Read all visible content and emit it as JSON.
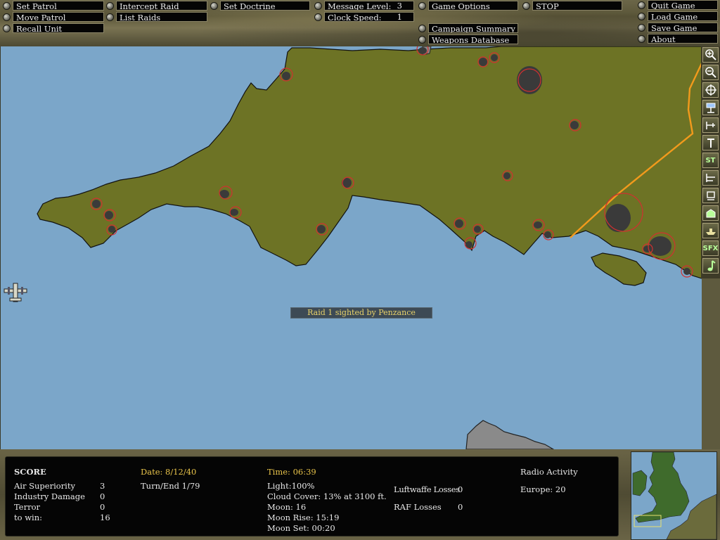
{
  "menu": {
    "set_patrol": "Set Patrol",
    "move_patrol": "Move Patrol",
    "recall_unit": "Recall Unit",
    "intercept_raid": "Intercept Raid",
    "list_raids": "List Raids",
    "set_doctrine": "Set Doctrine",
    "message_level_label": "Message Level:",
    "message_level_value": "3",
    "clock_speed_label": "Clock Speed:",
    "clock_speed_value": "1",
    "game_options": "Game Options",
    "campaign_summary": "Campaign Summary",
    "weapons_database": "Weapons Database",
    "stop": "STOP",
    "quit_game": "Quit Game",
    "load_game": "Load Game",
    "save_game": "Save Game",
    "about": "About"
  },
  "map": {
    "message": "Raid 1 sighted by Penzance",
    "colors": {
      "sea": "#7ba6c9",
      "land": "#6d7325",
      "town": "#3a3a3a",
      "circle": "#d03030",
      "border": "#f29a1c",
      "france": "#8a8a8a"
    }
  },
  "sidetools": {
    "icons": [
      "zoom-in-icon",
      "zoom-out-icon",
      "center-crosshair-icon",
      "radar-station-icon",
      "airfield-icon",
      "sector-station-icon",
      "st-toggle-icon",
      "grid-icon",
      "observer-icon",
      "factory-icon",
      "ship-icon",
      "sfx-toggle-icon",
      "music-icon"
    ],
    "st_label": "ST",
    "sfx_label": "SFX"
  },
  "score": {
    "heading": "SCORE",
    "air_superiority_label": "Air Superiority",
    "air_superiority_value": "3",
    "industry_damage_label": "Industry Damage",
    "industry_damage_value": "0",
    "terror_label": "Terror",
    "terror_value": "0",
    "to_win_label": "to win:",
    "to_win_value": "16",
    "date": "Date: 8/12/40",
    "turn_end": "Turn/End 1/79",
    "time": "Time: 06:39",
    "light": "Light:100%",
    "cloud_cover": "Cloud Cover: 13% at 3100 ft.",
    "moon": "Moon: 16",
    "moon_rise": "Moon Rise: 15:19",
    "moon_set": "Moon Set: 00:20",
    "luftwaffe_losses_label": "Luftwaffe Losses",
    "luftwaffe_losses_value": "0",
    "raf_losses_label": "RAF Losses",
    "raf_losses_value": "0",
    "radio_activity_label": "Radio Activity",
    "europe": "Europe: 20"
  }
}
